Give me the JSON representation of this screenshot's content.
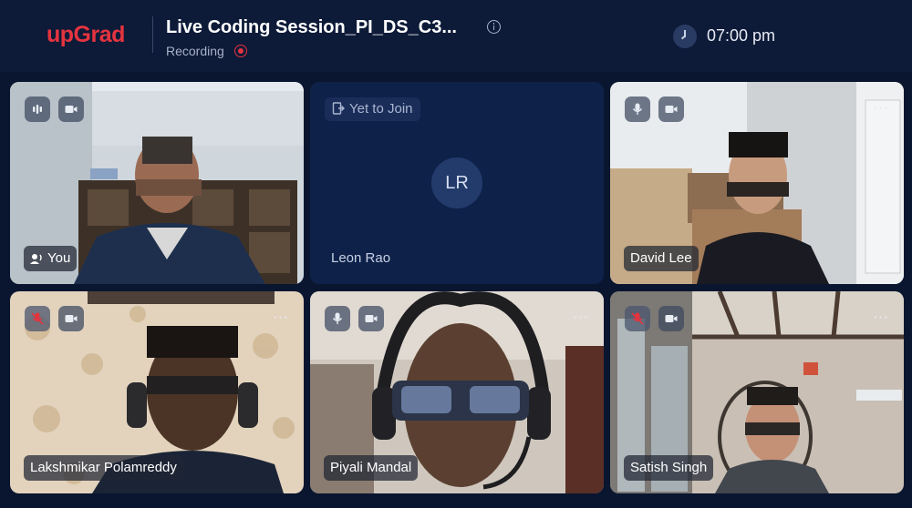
{
  "header": {
    "logo": "upGrad",
    "title": "Live Coding Session_PI_DS_C3...",
    "recording_label": "Recording",
    "time": "07:00 pm"
  },
  "participants": [
    {
      "name": "You",
      "status": "",
      "avatar_initials": ""
    },
    {
      "name": "Leon Rao",
      "status": "Yet to Join",
      "avatar_initials": "LR"
    },
    {
      "name": "David Lee",
      "status": "",
      "avatar_initials": ""
    },
    {
      "name": "Lakshmikar Polamreddy",
      "status": "",
      "avatar_initials": ""
    },
    {
      "name": "Piyali Mandal",
      "status": "",
      "avatar_initials": ""
    },
    {
      "name": "Satish Singh",
      "status": "",
      "avatar_initials": ""
    }
  ],
  "more_menu_glyph": "···",
  "colors": {
    "background": "#0d1a38",
    "brand_red": "#e4343f",
    "tile_empty": "#0e2149"
  }
}
